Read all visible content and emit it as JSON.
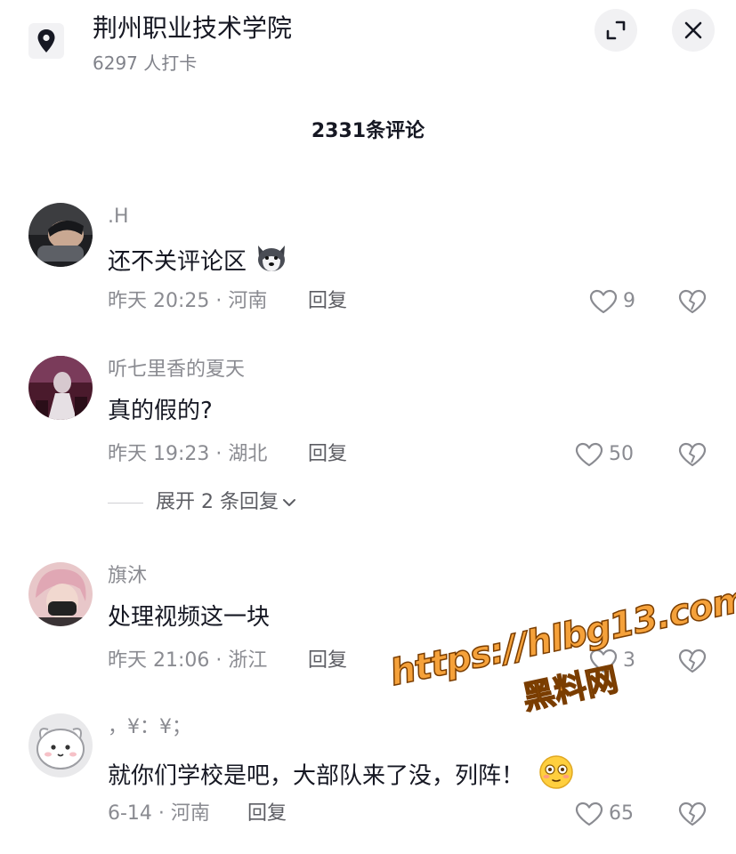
{
  "header": {
    "location_icon": "location-pin-icon",
    "title": "荆州职业技术学院",
    "checkins": "6297 人打卡",
    "expand_icon": "minimize-arrows-icon",
    "close_icon": "close-icon"
  },
  "comment_count": "2331条评论",
  "comments": [
    {
      "username": ".H",
      "text": "还不关评论区",
      "emoji": "husky-dog-emoji",
      "time_location": "昨天 20:25 · 河南",
      "reply": "回复",
      "likes": "9"
    },
    {
      "username": "听七里香的夏天",
      "text": "真的假的?",
      "time_location": "昨天 19:23 · 湖北",
      "reply": "回复",
      "likes": "50",
      "expand_replies": "展开 2 条回复"
    },
    {
      "username": "旗沐",
      "text": "处理视频这一块",
      "time_location": "昨天 21:06 · 浙江",
      "reply": "回复",
      "likes": "3"
    },
    {
      "username": "，¥：¥；",
      "text": "就你们学校是吧，大部队来了没，列阵！",
      "emoji": "flushed-face-emoji",
      "time_location": "6-14 · 河南",
      "reply": "回复",
      "likes": "65"
    }
  ],
  "watermark": {
    "url": "https://hlbg13.com",
    "name": "黑料网"
  },
  "colors": {
    "text_primary": "#161823",
    "text_secondary": "#8a8b91",
    "watermark_fill": "#f5a13a"
  }
}
